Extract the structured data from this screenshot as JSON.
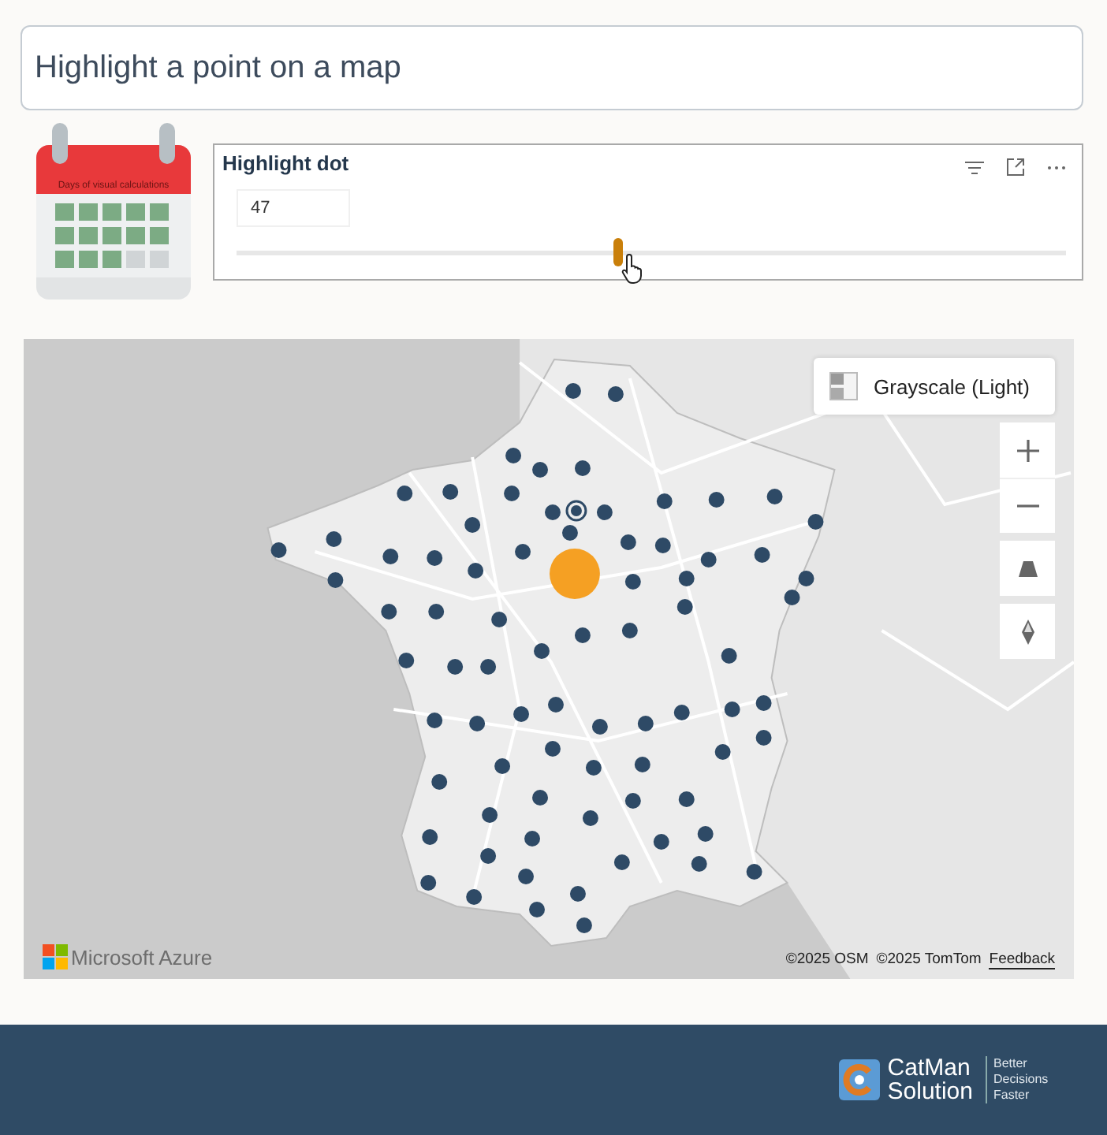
{
  "title": "Highlight a point on a map",
  "calendar": {
    "header": "Days of visual calculations"
  },
  "slicer": {
    "title": "Highlight dot",
    "value": "47",
    "level": 0.46
  },
  "map": {
    "style_button": "Grayscale (Light)",
    "brand": "Microsoft Azure",
    "attributions": [
      "©2025 OSM",
      "©2025 TomTom"
    ],
    "feedback": "Feedback"
  },
  "footer": {
    "brand_line1": "CatMan",
    "brand_line2": "Solution",
    "tagline": "Better Decisions Faster"
  }
}
